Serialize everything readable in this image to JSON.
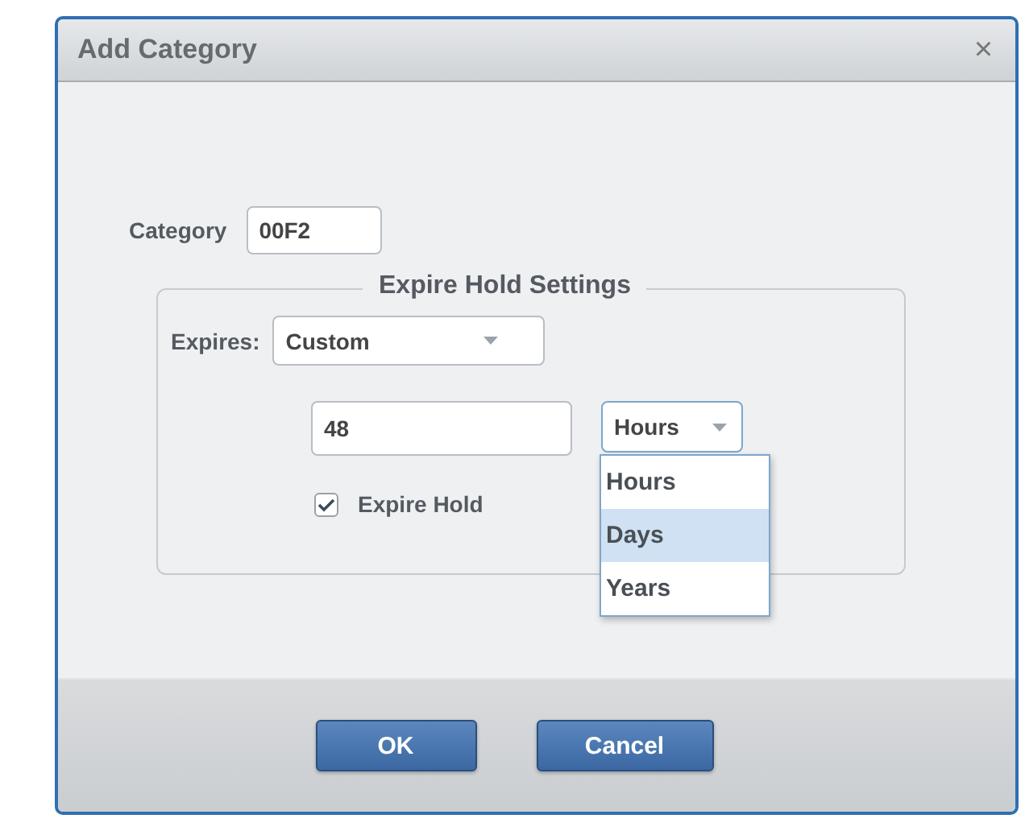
{
  "dialog": {
    "title": "Add Category",
    "close": "×"
  },
  "category": {
    "label": "Category",
    "value": "00F2"
  },
  "expire_settings": {
    "legend": "Expire Hold Settings",
    "expires_label": "Expires:",
    "expires_value": "Custom",
    "amount": "48",
    "unit": "Hours",
    "unit_options": [
      {
        "label": "Hours",
        "selected": false
      },
      {
        "label": "Days",
        "selected": true
      },
      {
        "label": "Years",
        "selected": false
      }
    ],
    "expire_hold": {
      "label": "Expire Hold",
      "checked": true
    }
  },
  "buttons": [
    "OK",
    "Cancel"
  ]
}
